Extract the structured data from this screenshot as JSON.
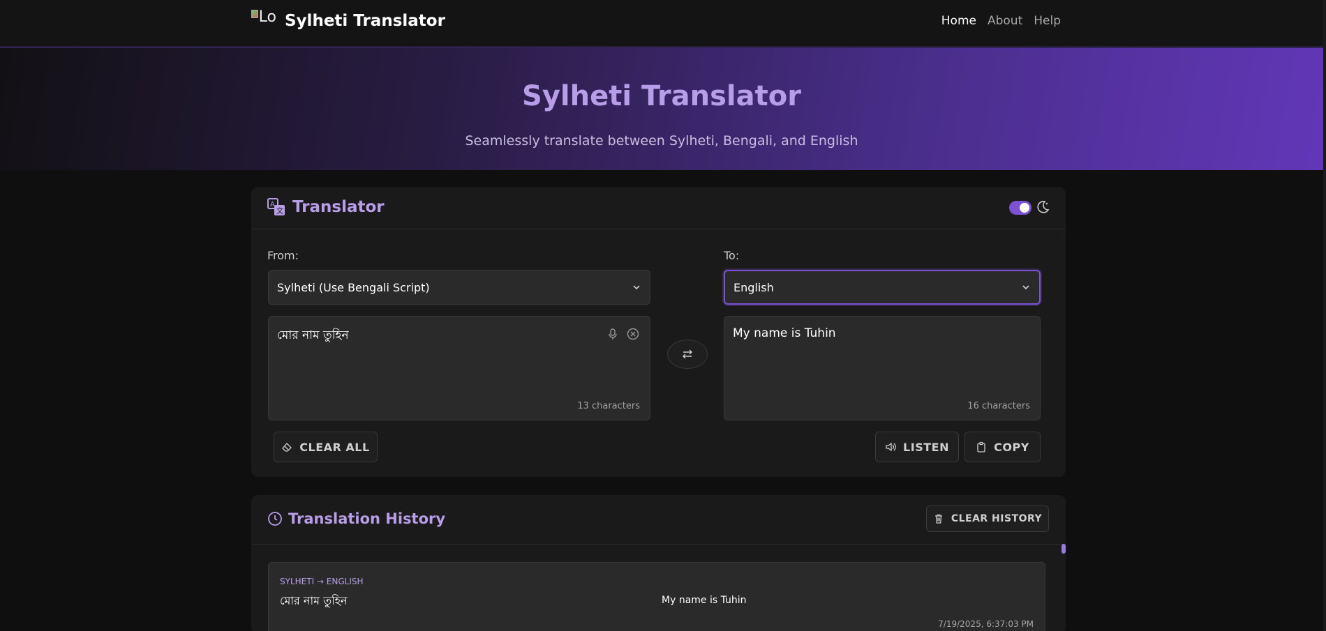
{
  "navbar": {
    "logo_alt": "Lo",
    "brand": "Sylheti Translator",
    "links": [
      {
        "label": "Home",
        "active": true
      },
      {
        "label": "About",
        "active": false
      },
      {
        "label": "Help",
        "active": false
      }
    ]
  },
  "hero": {
    "title": "Sylheti Translator",
    "subtitle": "Seamlessly translate between Sylheti, Bengali, and English"
  },
  "translator": {
    "title": "Translator",
    "title_icon": "translate-icon",
    "theme_toggle_icon": "moon-icon",
    "from_label": "From:",
    "to_label": "To:",
    "from_language": "Sylheti (Use Bengali Script)",
    "to_language": "English",
    "source_text": "মোর নাম তুহিন",
    "source_count": "13 characters",
    "target_text": "My name is Tuhin",
    "target_count": "16 characters",
    "clear_all_label": "CLEAR ALL",
    "listen_label": "LISTEN",
    "copy_label": "COPY"
  },
  "history": {
    "title": "Translation History",
    "clear_label": "CLEAR HISTORY",
    "items": [
      {
        "pair": "SYLHETI → ENGLISH",
        "source": "মোর নাম তুহিন",
        "target": "My name is Tuhin",
        "time": "7/19/2025, 6:37:03 PM"
      }
    ]
  },
  "colors": {
    "accent": "#7b52d4",
    "accent_text": "#b89ee8",
    "background": "#0f0f0f",
    "card": "#1a1a1a"
  }
}
